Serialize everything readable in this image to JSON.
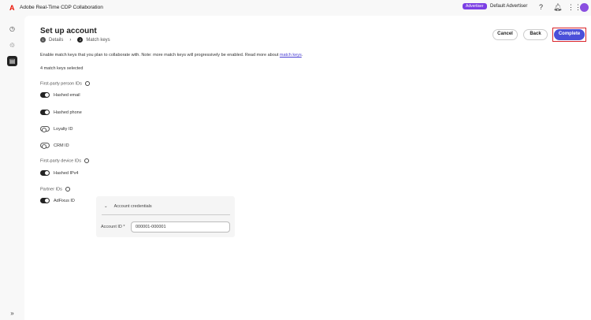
{
  "app": {
    "title": "Adobe Real-Time CDP Collaboration",
    "badge": "Advertiser",
    "account": "Default Advertiser"
  },
  "page": {
    "title": "Set up account",
    "steps": [
      {
        "num": "1",
        "label": "Details"
      },
      {
        "num": "2",
        "label": "Match keys"
      }
    ],
    "buttons": {
      "cancel": "Cancel",
      "back": "Back",
      "complete": "Complete"
    },
    "note": "Enable match keys that you plan to collaborate with. Note: more match keys will progressively be enabled. Read more about",
    "note_link": "match keys",
    "selected": "4 match keys selected",
    "sections": {
      "person": "First-party person IDs",
      "device": "First-party device IDs",
      "partner": "Partner IDs"
    },
    "keys": [
      {
        "label": "Hashed email",
        "on": true
      },
      {
        "label": "Hashed phone",
        "on": true
      },
      {
        "label": "Loyalty ID",
        "on": false
      },
      {
        "label": "CRM ID",
        "on": false
      },
      {
        "label": "Hashed IPv4",
        "on": true
      },
      {
        "label": "AdFixus ID",
        "on": true
      }
    ],
    "credentials": {
      "title": "Account credentials",
      "field_label": "Account ID *",
      "field_value": "000001-000001"
    }
  },
  "colors": {
    "accent": "#4b4fd9",
    "badge": "#7b3fe4",
    "highlight": "#d9242a"
  }
}
